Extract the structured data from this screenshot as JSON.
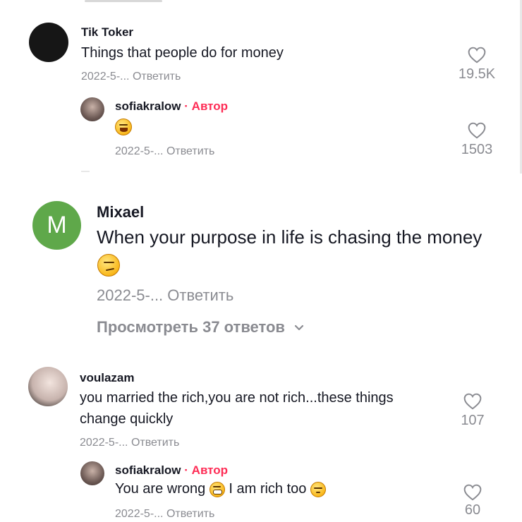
{
  "comments": [
    {
      "username": "Tik Toker",
      "text": "Things that people do for money",
      "date": "2022-5-...",
      "reply_label": "Ответить",
      "likes": "19.5K",
      "avatar_color": "#161616",
      "reply": {
        "username": "sofiakralow",
        "author_tag": "· Автор",
        "emoji": "laughing-face",
        "date": "2022-5-...",
        "reply_label": "Ответить",
        "likes": "1503"
      }
    },
    {
      "username": "Mixael",
      "avatar_letter": "M",
      "avatar_color": "#5fa84a",
      "text": "When your purpose in life is chasing the money",
      "emoji": "smirking-face",
      "date": "2022-5-...",
      "reply_label": "Ответить",
      "view_replies": "Просмотреть 37 ответов"
    },
    {
      "username": "voulazam",
      "text_line1": "you married the rich,you are not rich...these things",
      "text_line2": "change quickly",
      "date": "2022-5-...",
      "reply_label": "Ответить",
      "likes": "107",
      "reply": {
        "username": "sofiakralow",
        "author_tag": "· Автор",
        "text_a": "You are wrong",
        "text_b": "I am rich too",
        "date": "2022-5-...",
        "reply_label": "Ответить",
        "likes": "60"
      }
    }
  ],
  "colors": {
    "author_tag": "#fe2c55",
    "meta_text": "#8a8b91",
    "text": "#161823"
  }
}
